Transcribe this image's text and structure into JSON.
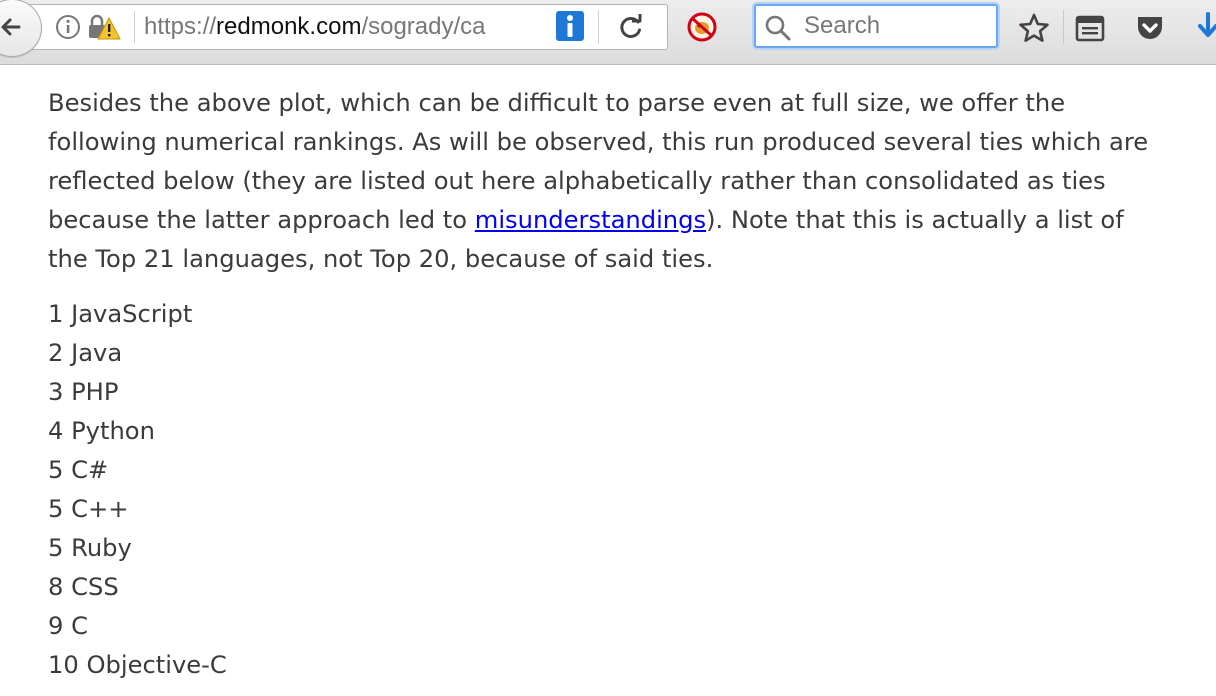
{
  "browser": {
    "url_prefix": "https://",
    "url_host": "redmonk.com",
    "url_path": "/sogrady/ca",
    "search_placeholder": "Search"
  },
  "article": {
    "paragraph_before": "Besides the above plot, which can be difficult to parse even at full size, we offer the following numerical rankings. As will be observed, this run produced several ties which are reflected below (they are listed out here alphabetically rather than consolidated as ties because the latter approach led to ",
    "link_text": "misunderstandings",
    "paragraph_after": "). Note that this is actually a list of the Top 21 languages, not Top 20, because of said ties."
  },
  "rankings": [
    {
      "rank": "1",
      "language": "JavaScript"
    },
    {
      "rank": "2",
      "language": "Java"
    },
    {
      "rank": "3",
      "language": "PHP"
    },
    {
      "rank": "4",
      "language": "Python"
    },
    {
      "rank": "5",
      "language": "C#"
    },
    {
      "rank": "5",
      "language": "C++"
    },
    {
      "rank": "5",
      "language": "Ruby"
    },
    {
      "rank": "8",
      "language": "CSS"
    },
    {
      "rank": "9",
      "language": "C"
    },
    {
      "rank": "10",
      "language": "Objective-C"
    }
  ],
  "icons": {
    "back": "back-arrow-icon",
    "info": "info-icon",
    "insecure": "lock-warning-icon",
    "reader": "reader-view-icon",
    "reload": "reload-icon",
    "addon": "blocked-addon-icon",
    "search": "magnifier-icon",
    "bookmark": "star-icon",
    "library": "bookmarks-list-icon",
    "pocket": "pocket-icon",
    "downloads": "download-icon"
  },
  "colors": {
    "link": "#0000ee",
    "text": "#3b3b3b",
    "search_focus": "#6aa7ef",
    "reader_blue": "#1e78d6"
  }
}
